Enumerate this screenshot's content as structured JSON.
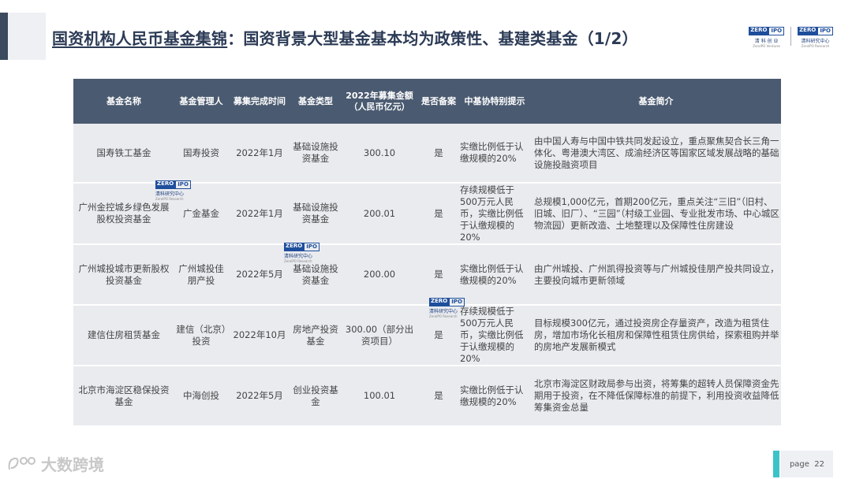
{
  "header": {
    "title_underlined": "国资机构人民币基金集锦",
    "title_rest": "：国资背景大型基金基本均为政策性、基建类基金（1/2）"
  },
  "logos": {
    "zero": "ZERO",
    "ipo": "IPO",
    "logo1_cn": "清 科 创 业",
    "logo1_en": "ZeroIPO Ventures",
    "logo2_cn": "清科研究中心",
    "logo2_en": "ZeroIPO Research"
  },
  "table": {
    "headers": [
      "基金名称",
      "基金管理人",
      "募集完成时间",
      "基金类型",
      "2022年募集金额（人民币亿元）",
      "是否备案",
      "中基协特别提示",
      "基金简介"
    ],
    "rows": [
      [
        "国寿铁工基金",
        "国寿投资",
        "2022年1月",
        "基础设施投资基金",
        "300.10",
        "是",
        "实缴比例低于认缴规模的20%",
        "由中国人寿与中国中铁共同发起设立，重点聚焦契合长三角一体化、粤港澳大湾区、成渝经济区等国家区域发展战略的基础设施投融资项目"
      ],
      [
        "广州金控城乡绿色发展股权投资基金",
        "广金基金",
        "2022年1月",
        "基础设施投资基金",
        "200.01",
        "是",
        "存续规模低于500万元人民币，实缴比例低于认缴规模的20%",
        "总规模1,000亿元，首期200亿元，重点关注“三旧”（旧村、旧城、旧厂）、“三园”（村级工业园、专业批发市场、中心城区物流园）更新改造、土地整理以及保障性住房建设"
      ],
      [
        "广州城投城市更新股权投资基金",
        "广州城投佳朋产投",
        "2022年5月",
        "基础设施投资基金",
        "200.00",
        "是",
        "实缴比例低于认缴规模的20%",
        "由广州城投、广州凯得投资等与广州城投佳朋产投共同设立，主要投向城市更新领域"
      ],
      [
        "建信住房租赁基金",
        "建信（北京）投资",
        "2022年10月",
        "房地产投资基金",
        "300.00（部分出资项目）",
        "是",
        "存续规模低于500万元人民币，实缴比例低于认缴规模的20%",
        "目标规模300亿元，通过投资房企存量资产，改造为租赁住房，增加市场化长租房和保障性租赁住房供给，探索租购并举的房地产发展新模式"
      ],
      [
        "北京市海淀区稳保投资基金",
        "中海创投",
        "2022年5月",
        "创业投资基金",
        "100.01",
        "是",
        "实缴比例低于认缴规模的20%",
        "北京市海淀区财政局参与出资，将筹集的超转人员保障资金先期用于投资，在不降低保障标准的前提下，利用投资收益降低筹集资金总量"
      ]
    ]
  },
  "footer": {
    "brand": "大数跨境",
    "page_label": "page",
    "page_number": "22"
  }
}
